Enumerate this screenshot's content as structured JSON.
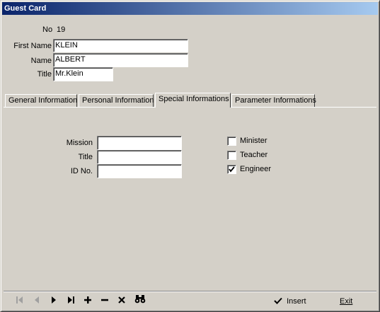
{
  "window": {
    "title": "Guest Card"
  },
  "header": {
    "no_label": "No",
    "no_value": "19",
    "first_name_label": "First Name",
    "first_name_value": "KLEIN",
    "name_label": "Name",
    "name_value": "ALBERT",
    "title_label": "Title",
    "title_value": "Mr.Klein"
  },
  "tabs": [
    {
      "label": "General Information",
      "active": false
    },
    {
      "label": "Personal Information",
      "active": false
    },
    {
      "label": "Special Informations",
      "active": true
    },
    {
      "label": "Parameter Informations",
      "active": false
    }
  ],
  "special": {
    "mission_label": "Mission",
    "mission_value": "",
    "title_label": "Title",
    "title_value": "",
    "idno_label": "ID No.",
    "idno_value": "",
    "checkboxes": [
      {
        "label": "Minister",
        "checked": false
      },
      {
        "label": "Teacher",
        "checked": false
      },
      {
        "label": "Engineer",
        "checked": true
      }
    ]
  },
  "toolbar": {
    "insert_label": "Insert",
    "exit_label": "Exit"
  }
}
